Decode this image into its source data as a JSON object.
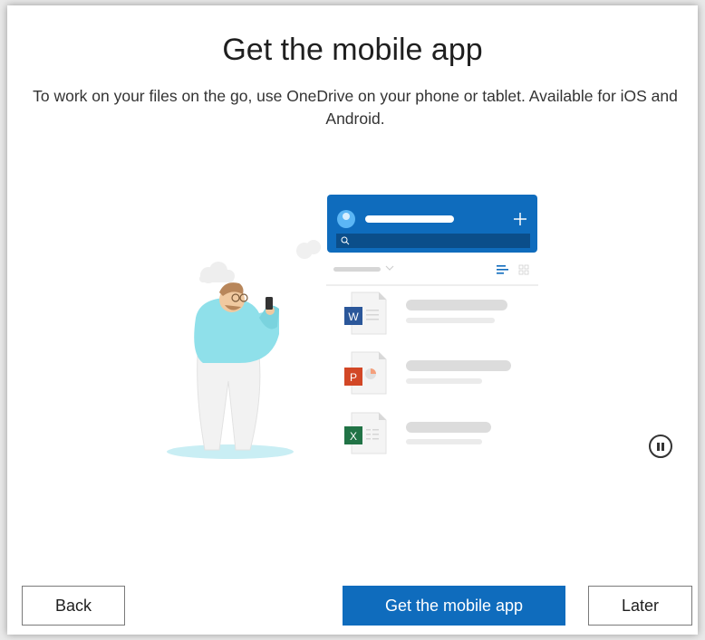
{
  "dialog": {
    "title": "Get the mobile app",
    "subtitle": "To work on your files on the go, use OneDrive on your phone or tablet. Available for iOS and Android."
  },
  "illustration": {
    "word_letter": "W",
    "powerpoint_letter": "P",
    "excel_letter": "X",
    "colors": {
      "header_blue": "#0f6cbd",
      "search_bar": "#0b4e8a",
      "word": "#2b579a",
      "powerpoint": "#d24726",
      "excel": "#217346",
      "shirt": "#8fe0ea",
      "shadow": "#c9eef4"
    }
  },
  "controls": {
    "pause_icon": "pause-icon"
  },
  "buttons": {
    "back": "Back",
    "primary": "Get the mobile app",
    "later": "Later"
  }
}
